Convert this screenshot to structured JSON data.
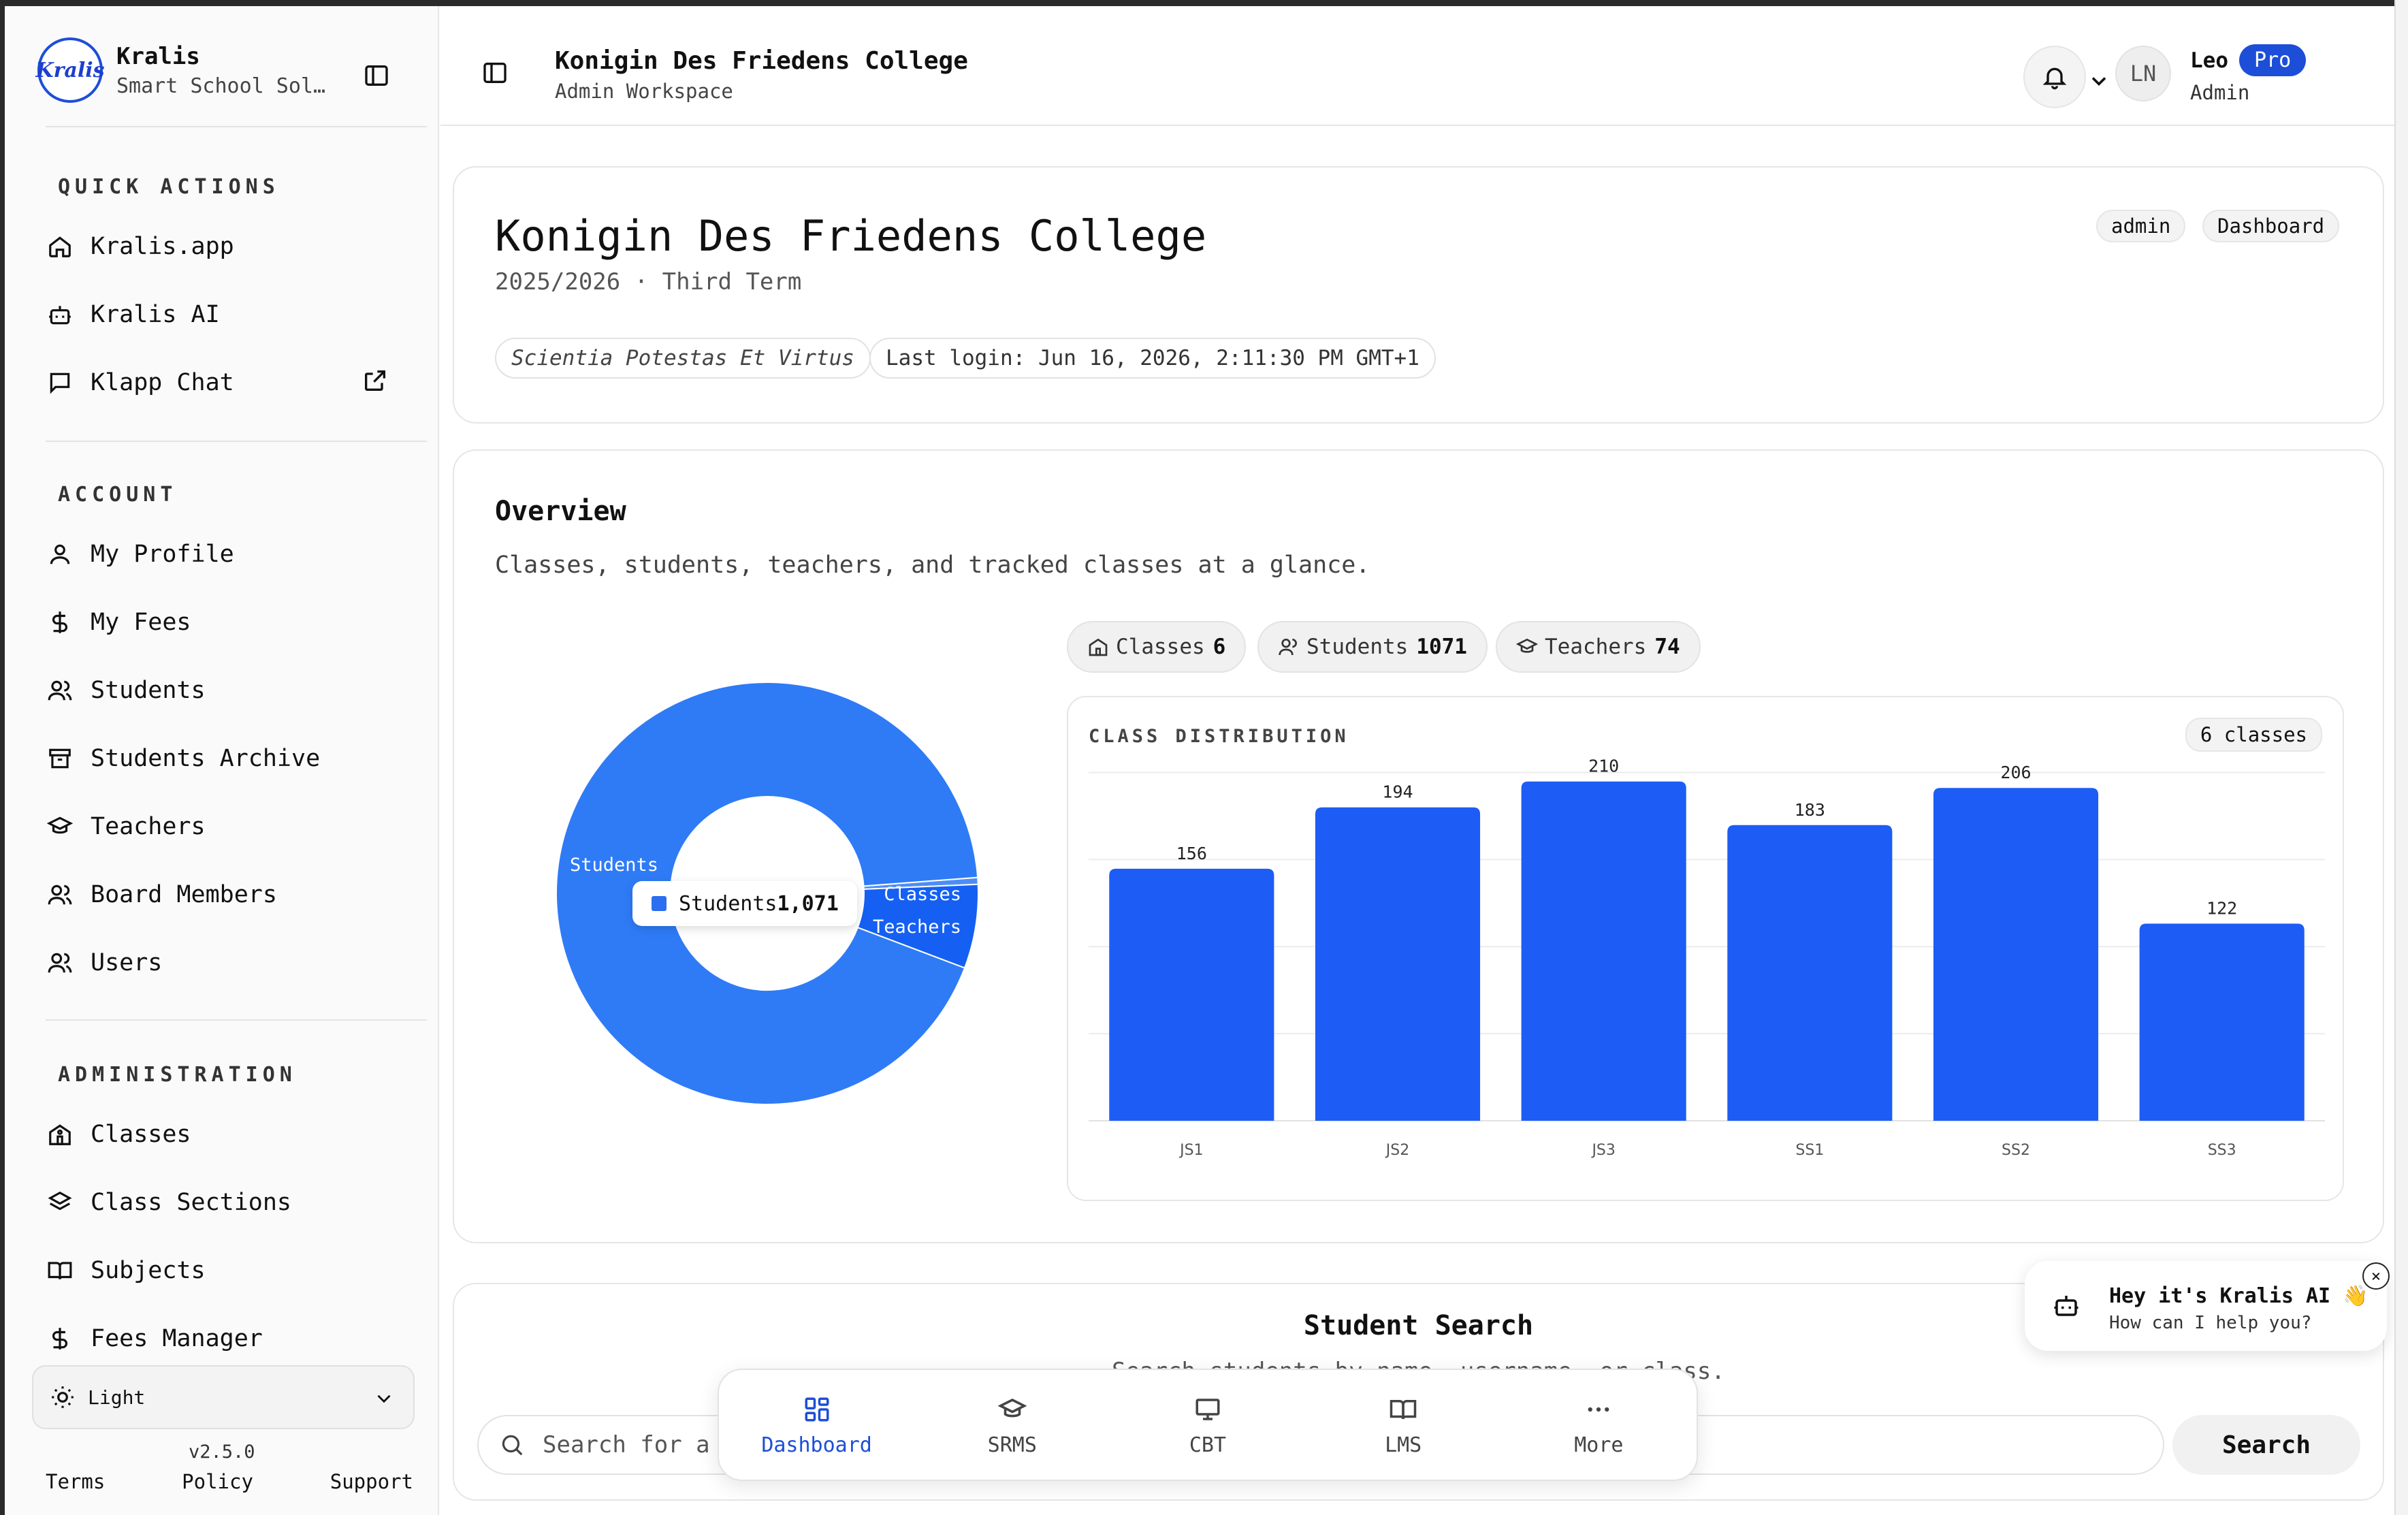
{
  "brand": {
    "name": "Kralis",
    "subtitle": "Smart School Sol…",
    "logo_text": "Kralis"
  },
  "sidebar": {
    "sections": [
      {
        "title": "QUICK ACTIONS",
        "items": [
          {
            "label": "Kralis.app",
            "icon": "home-icon"
          },
          {
            "label": "Kralis AI",
            "icon": "bot-icon"
          },
          {
            "label": "Klapp Chat",
            "icon": "message-icon",
            "external": true
          }
        ]
      },
      {
        "title": "ACCOUNT",
        "items": [
          {
            "label": "My Profile",
            "icon": "user-icon"
          },
          {
            "label": "My Fees",
            "icon": "dollar-icon"
          },
          {
            "label": "Students",
            "icon": "users-icon"
          },
          {
            "label": "Students Archive",
            "icon": "archive-icon"
          },
          {
            "label": "Teachers",
            "icon": "graduation-cap-icon"
          },
          {
            "label": "Board Members",
            "icon": "users-icon"
          },
          {
            "label": "Users",
            "icon": "users-icon"
          }
        ]
      },
      {
        "title": "ADMINISTRATION",
        "items": [
          {
            "label": "Classes",
            "icon": "school-icon"
          },
          {
            "label": "Class Sections",
            "icon": "layers-icon"
          },
          {
            "label": "Subjects",
            "icon": "book-icon"
          },
          {
            "label": "Fees Manager",
            "icon": "dollar-icon"
          }
        ]
      }
    ],
    "theme": "Light",
    "version": "v2.5.0",
    "footer_links": [
      "Terms",
      "Policy",
      "Support"
    ]
  },
  "header": {
    "title": "Konigin Des Friedens College",
    "subtitle": "Admin Workspace",
    "user": {
      "initials": "LN",
      "name": "Leo",
      "badge": "Pro",
      "role": "Admin"
    }
  },
  "school": {
    "name": "Konigin Des Friedens College",
    "term": "2025/2026 · Third Term",
    "motto": "Scientia Potestas Et Virtus",
    "last_login": "Last login: Jun 16, 2026, 2:11:30 PM GMT+1",
    "tags": [
      "admin",
      "Dashboard"
    ]
  },
  "overview": {
    "title": "Overview",
    "subtitle": "Classes, students, teachers, and tracked classes at a glance.",
    "stats": [
      {
        "label": "Classes",
        "value": "6",
        "icon": "school-icon"
      },
      {
        "label": "Students",
        "value": "1071",
        "icon": "users-icon"
      },
      {
        "label": "Teachers",
        "value": "74",
        "icon": "graduation-cap-icon"
      }
    ],
    "tooltip": {
      "label": "Students",
      "value": "1,071"
    },
    "distribution_title": "CLASS DISTRIBUTION",
    "distribution_count": "6 classes"
  },
  "chart_data": [
    {
      "type": "pie",
      "donut": true,
      "labels": [
        "Students",
        "Classes",
        "Teachers"
      ],
      "values": [
        1071,
        6,
        74
      ],
      "colors": [
        "#2f7bf6",
        "#4d8df7",
        "#1560f2"
      ]
    },
    {
      "type": "bar",
      "categories": [
        "JS1",
        "JS2",
        "JS3",
        "SS1",
        "SS2",
        "SS3"
      ],
      "values": [
        156,
        194,
        210,
        183,
        206,
        122
      ],
      "ylim": [
        0,
        220
      ],
      "grid": true,
      "color": "#1d5cf5"
    }
  ],
  "student_search": {
    "title": "Student Search",
    "subtitle": "Search students by name, username, or class.",
    "placeholder": "Search for a",
    "button": "Search"
  },
  "bottom_nav": [
    {
      "label": "Dashboard",
      "icon": "grid-icon",
      "active": true
    },
    {
      "label": "SRMS",
      "icon": "graduation-cap-icon"
    },
    {
      "label": "CBT",
      "icon": "monitor-icon"
    },
    {
      "label": "LMS",
      "icon": "book-open-icon"
    },
    {
      "label": "More",
      "icon": "more-icon"
    }
  ],
  "chat": {
    "title": "Hey it's Kralis AI 👋",
    "subtitle": "How can I help you?"
  }
}
